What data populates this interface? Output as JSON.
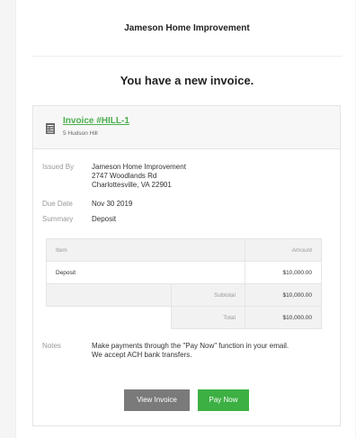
{
  "header": {
    "company_name": "Jameson Home Improvement",
    "headline": "You have a new invoice."
  },
  "invoice": {
    "icon": "document-icon",
    "number": "Invoice #HILL-1",
    "address": "5 Hudson Hill",
    "issued_by_label": "Issued By",
    "issued_by_name": "Jameson Home Improvement",
    "issued_by_street": "2747 Woodlands Rd",
    "issued_by_city": "Charlottesville, VA 22901",
    "due_date_label": "Due Date",
    "due_date": "Nov 30 2019",
    "summary_label": "Summary",
    "summary": "Deposit"
  },
  "table": {
    "col_item": "Item",
    "col_amount": "Amount",
    "rows": [
      {
        "item": "Deposit",
        "amount": "$10,000.00"
      }
    ],
    "subtotal_label": "Subtotal",
    "subtotal": "$10,000.00",
    "total_label": "Total",
    "total": "$10,000.00"
  },
  "notes": {
    "label": "Notes",
    "line1": "Make payments through the \"Pay Now\" function in your email.",
    "line2": "We accept ACH bank transfers."
  },
  "actions": {
    "view_label": "View Invoice",
    "pay_label": "Pay Now"
  },
  "colors": {
    "accent_green": "#3cb043",
    "link_green": "#4caf50",
    "button_gray": "#7a7a7a"
  }
}
